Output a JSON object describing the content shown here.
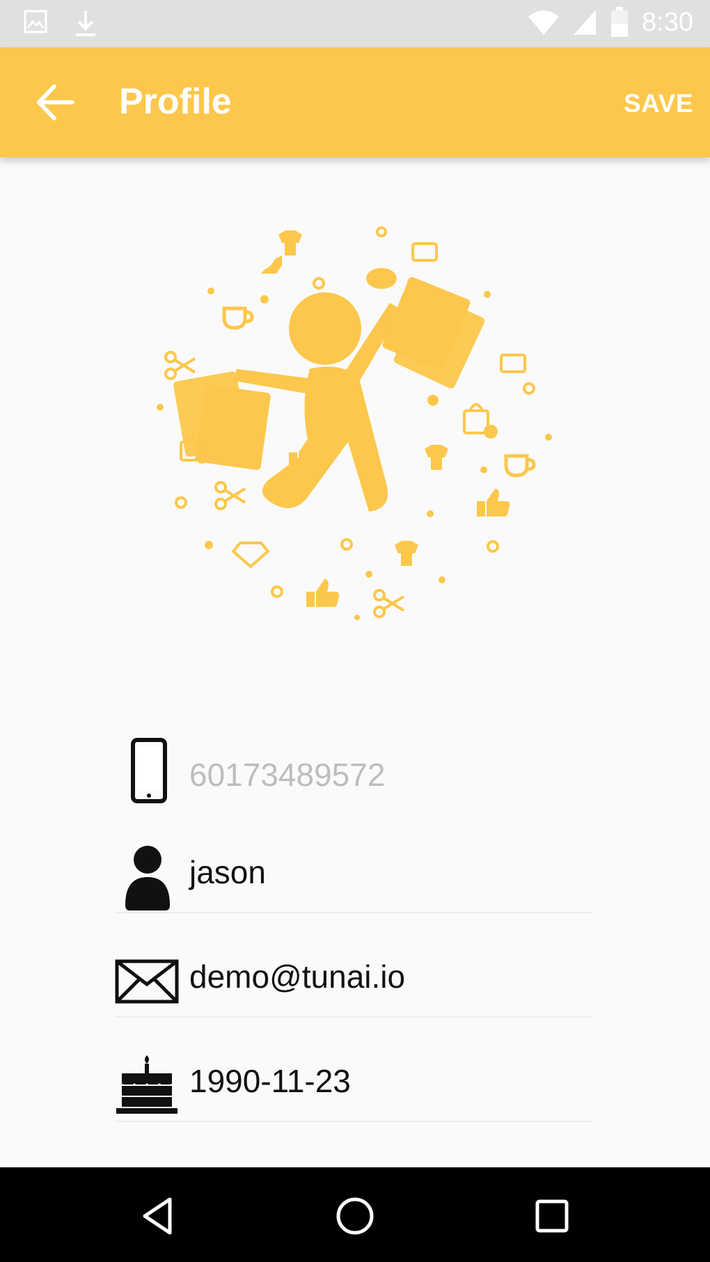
{
  "status_bar": {
    "time": "8:30",
    "icons": [
      "gallery-icon",
      "download-icon",
      "wifi-icon",
      "signal-icon",
      "battery-icon"
    ]
  },
  "app_bar": {
    "title": "Profile",
    "save_label": "SAVE",
    "background_color": "#fcc74c",
    "icons": [
      "back-arrow-icon"
    ]
  },
  "hero": {
    "icon": "shopping-person-illustration",
    "accent_color": "#fcc74c"
  },
  "profile": {
    "phone": {
      "value": "60173489572",
      "icon": "phone-icon"
    },
    "name": {
      "value": "jason",
      "icon": "person-icon"
    },
    "email": {
      "value": "demo@tunai.io",
      "icon": "envelope-icon"
    },
    "birthday": {
      "value": "1990-11-23",
      "icon": "birthday-cake-icon"
    }
  },
  "nav_bar": {
    "icons": [
      "nav-back-icon",
      "nav-home-icon",
      "nav-recents-icon"
    ]
  }
}
